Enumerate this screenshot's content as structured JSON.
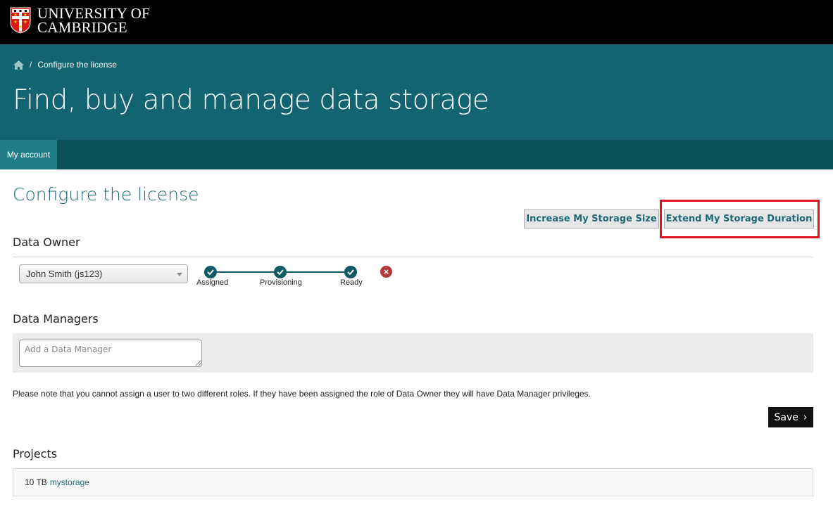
{
  "header": {
    "logo_line1": "UNIVERSITY OF",
    "logo_line2": "CAMBRIDGE"
  },
  "breadcrumb": {
    "home_icon": "home-icon",
    "separator": "/",
    "current": "Configure the license"
  },
  "banner": {
    "title": "Find, buy and manage data storage"
  },
  "nav": {
    "tabs": [
      {
        "label": "My account"
      }
    ]
  },
  "page": {
    "heading": "Configure the license",
    "actions": {
      "increase_label": "Increase My Storage Size",
      "extend_label": "Extend My Storage Duration"
    },
    "owner": {
      "heading": "Data Owner",
      "selected": "John Smith (js123)",
      "steps": [
        {
          "label": "Assigned",
          "icon": "check-icon"
        },
        {
          "label": "Provisioning",
          "icon": "check-icon"
        },
        {
          "label": "Ready",
          "icon": "check-icon"
        }
      ],
      "remove_icon": "close-circle-icon"
    },
    "managers": {
      "heading": "Data Managers",
      "input_placeholder": "Add a Data Manager",
      "input_value": ""
    },
    "note": "Please note that you cannot assign a user to two different roles. If they have been assigned the role of Data Owner they will have Data Manager privileges.",
    "save_label": "Save",
    "projects": {
      "heading": "Projects",
      "items": [
        {
          "size": "10 TB",
          "name": "mystorage"
        }
      ]
    }
  },
  "colors": {
    "banner": "#116470",
    "nav": "#0c5059",
    "nav_active": "#1f7e88",
    "accent_text": "#1d6a74",
    "highlight": "#e0141e",
    "step": "#0f5a63",
    "remove": "#b33a3a"
  }
}
